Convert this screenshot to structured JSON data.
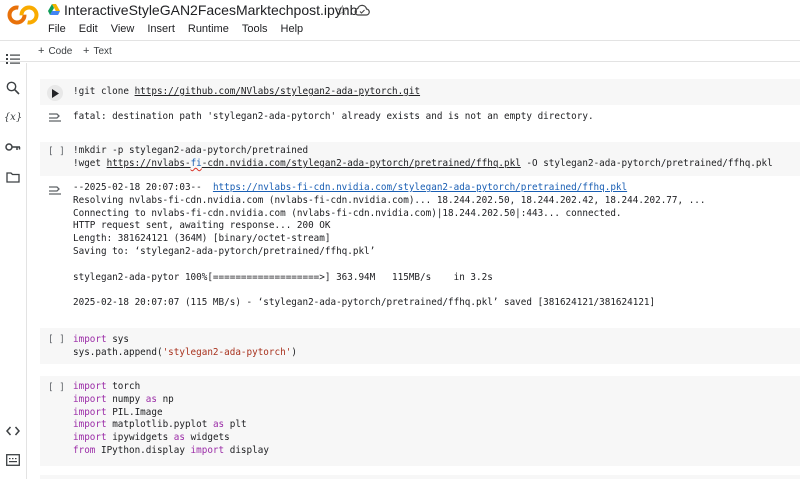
{
  "app": {
    "title": "InteractiveStyleGAN2FacesMarktechpost.ipynb",
    "logo_text": "CO",
    "colors": {
      "logo_orange": "#f9ab00",
      "logo_orange_dark": "#e8710a",
      "link": "#1a5fb4",
      "keyword": "#9b2ca7",
      "string": "#a8321e"
    }
  },
  "menu": [
    "File",
    "Edit",
    "View",
    "Insert",
    "Runtime",
    "Tools",
    "Help"
  ],
  "toolbar": {
    "code_label": "Code",
    "text_label": "Text"
  },
  "sidebar": {
    "icons": [
      "table-of-contents-icon",
      "search-icon",
      "variables-icon",
      "key-icon",
      "folder-icon",
      "code-snippets-icon",
      "terminal-icon"
    ],
    "variables_glyph": "{x}"
  },
  "cells": {
    "c1": {
      "code": "!git clone ",
      "url": "https://github.com/NVlabs/stylegan2-ada-pytorch.git",
      "output": "fatal: destination path 'stylegan2-ada-pytorch' already exists and is not an empty directory."
    },
    "c2": {
      "bracket": "[ ]",
      "line1": "!mkdir -p stylegan2-ada-pytorch/pretrained",
      "line2_pre": "!wget ",
      "line2_url_a": "https://nvlabs-",
      "line2_url_b": "fi",
      "line2_url_c": "-cdn.nvidia.com/stylegan2-ada-pytorch/pretrained/ffhq.pkl",
      "line2_post": " -O stylegan2-ada-pytorch/pretrained/ffhq.pkl",
      "output_first_pre": "--2025-02-18 20:07:03--  ",
      "output_first_url": "https://nvlabs-fi-cdn.nvidia.com/stylegan2-ada-pytorch/pretrained/ffhq.pkl",
      "output_lines": [
        "Resolving nvlabs-fi-cdn.nvidia.com (nvlabs-fi-cdn.nvidia.com)... 18.244.202.50, 18.244.202.42, 18.244.202.77, ...",
        "Connecting to nvlabs-fi-cdn.nvidia.com (nvlabs-fi-cdn.nvidia.com)|18.244.202.50|:443... connected.",
        "HTTP request sent, awaiting response... 200 OK",
        "Length: 381624121 (364M) [binary/octet-stream]",
        "Saving to: ‘stylegan2-ada-pytorch/pretrained/ffhq.pkl’",
        "",
        "stylegan2-ada-pytor 100%[===================>] 363.94M   115MB/s    in 3.2s",
        "",
        "2025-02-18 20:07:07 (115 MB/s) - ‘stylegan2-ada-pytorch/pretrained/ffhq.pkl’ saved [381624121/381624121]"
      ]
    },
    "c3": {
      "bracket": "[ ]",
      "import_kw": "import",
      "line1_rest": " sys",
      "line2_pre": "sys.path.append(",
      "line2_str": "'stylegan2-ada-pytorch'",
      "line2_post": ")"
    },
    "c4": {
      "bracket": "[ ]",
      "l1_kw": "import",
      "l1_rest": " torch",
      "l2_kw": "import",
      "l2_mid": " numpy ",
      "l2_as": "as",
      "l2_end": " np",
      "l3_kw": "import",
      "l3_rest": " PIL.Image",
      "l4_kw": "import",
      "l4_mid": " matplotlib.pyplot ",
      "l4_as": "as",
      "l4_end": " plt",
      "l5_kw": "import",
      "l5_mid": " ipywidgets ",
      "l5_as": "as",
      "l5_end": " widgets",
      "l6_from": "from",
      "l6_mid": " IPython.display ",
      "l6_imp": "import",
      "l6_end": " display"
    }
  }
}
